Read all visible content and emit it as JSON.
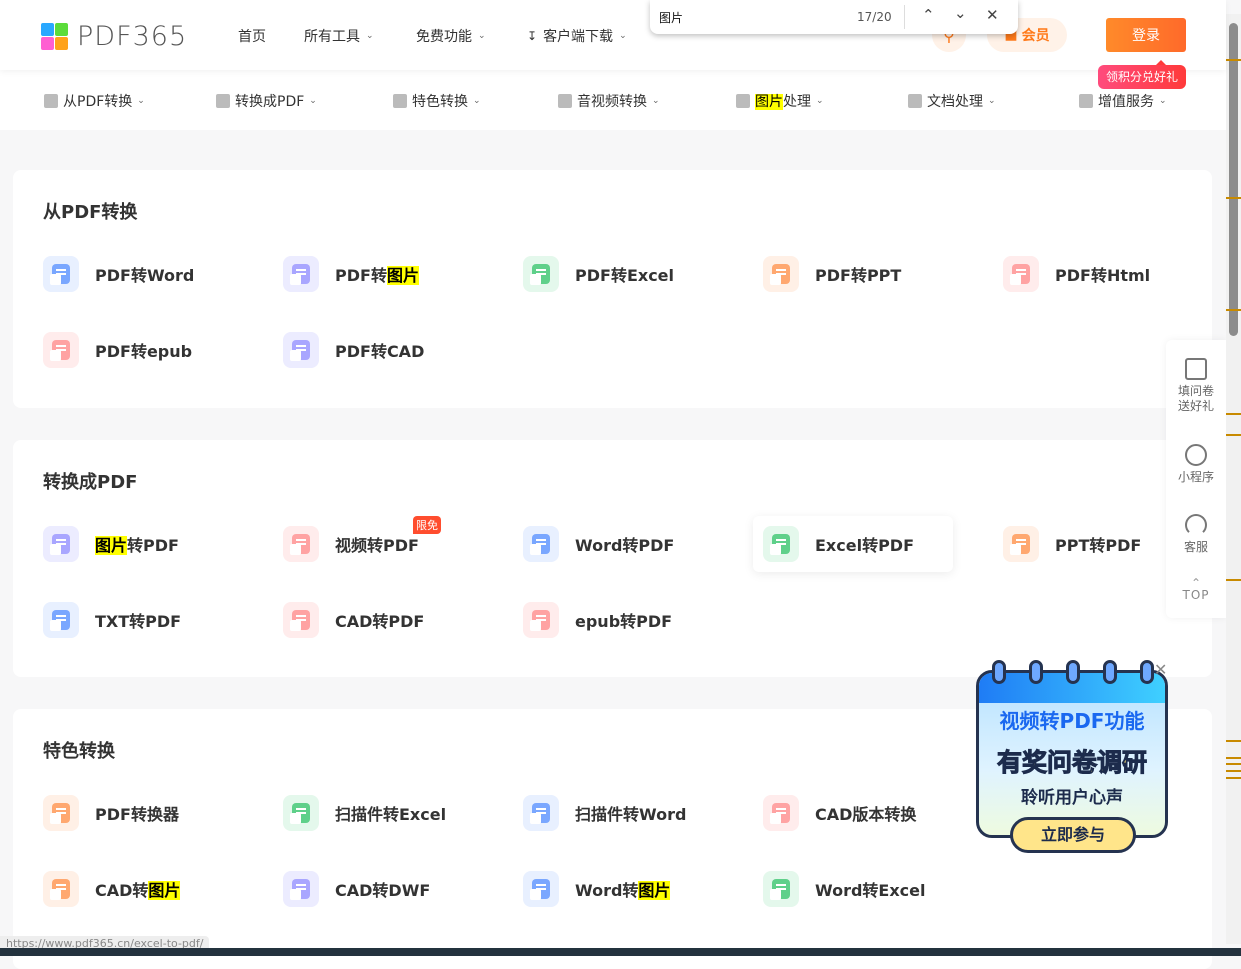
{
  "header": {
    "logo_text": "PDF365",
    "nav": [
      {
        "label": "首页"
      },
      {
        "label": "所有工具"
      },
      {
        "label": "免费功能"
      },
      {
        "label": "客户端下载"
      }
    ],
    "member_label": "会员",
    "login_label": "登录",
    "gift_tip": "领积分兑好礼"
  },
  "find_bar": {
    "query": "图片",
    "count": "17/20"
  },
  "subnav": [
    {
      "before": "从PDF转换",
      "hl": "",
      "after": ""
    },
    {
      "before": "转换成PDF",
      "hl": "",
      "after": ""
    },
    {
      "before": "特色转换",
      "hl": "",
      "after": ""
    },
    {
      "before": "音视频转换",
      "hl": "",
      "after": ""
    },
    {
      "before": "",
      "hl": "图片",
      "after": "处理"
    },
    {
      "before": "文档处理",
      "hl": "",
      "after": ""
    },
    {
      "before": "增值服务",
      "hl": "",
      "after": ""
    }
  ],
  "sections": [
    {
      "title": "从PDF转换",
      "tools": [
        {
          "before": "PDF转Word",
          "hl": "",
          "after": "",
          "color": "#7aa7ff",
          "bg": "#e8f0ff"
        },
        {
          "before": "PDF转",
          "hl": "图片",
          "after": "",
          "color": "#a9a6ff",
          "bg": "#ececff"
        },
        {
          "before": "PDF转Excel",
          "hl": "",
          "after": "",
          "color": "#5fd08a",
          "bg": "#e4f8ec"
        },
        {
          "before": "PDF转PPT",
          "hl": "",
          "after": "",
          "color": "#ffa870",
          "bg": "#fff0e6"
        },
        {
          "before": "PDF转Html",
          "hl": "",
          "after": "",
          "color": "#ffa3a3",
          "bg": "#ffecec"
        },
        {
          "before": "PDF转epub",
          "hl": "",
          "after": "",
          "color": "#ffa3a3",
          "bg": "#ffecec"
        },
        {
          "before": "PDF转CAD",
          "hl": "",
          "after": "",
          "color": "#a9a6ff",
          "bg": "#ececff"
        }
      ]
    },
    {
      "title": "转换成PDF",
      "tools": [
        {
          "before": "",
          "hl": "图片",
          "after": "转PDF",
          "color": "#a9a6ff",
          "bg": "#ececff"
        },
        {
          "before": "视频转PDF",
          "hl": "",
          "after": "",
          "color": "#ffa3a3",
          "bg": "#ffecec",
          "badge": "限免"
        },
        {
          "before": "Word转PDF",
          "hl": "",
          "after": "",
          "color": "#7aa7ff",
          "bg": "#e8f0ff"
        },
        {
          "before": "Excel转PDF",
          "hl": "",
          "after": "",
          "color": "#5fd08a",
          "bg": "#e4f8ec",
          "hover": true
        },
        {
          "before": "PPT转PDF",
          "hl": "",
          "after": "",
          "color": "#ffa870",
          "bg": "#fff0e6"
        },
        {
          "before": "TXT转PDF",
          "hl": "",
          "after": "",
          "color": "#7aa7ff",
          "bg": "#e8f0ff"
        },
        {
          "before": "CAD转PDF",
          "hl": "",
          "after": "",
          "color": "#ffa3a3",
          "bg": "#ffecec"
        },
        {
          "before": "epub转PDF",
          "hl": "",
          "after": "",
          "color": "#ffa3a3",
          "bg": "#ffecec"
        }
      ]
    },
    {
      "title": "特色转换",
      "tools": [
        {
          "before": "PDF转换器",
          "hl": "",
          "after": "",
          "color": "#ffa870",
          "bg": "#fff0e6"
        },
        {
          "before": "扫描件转Excel",
          "hl": "",
          "after": "",
          "color": "#5fd08a",
          "bg": "#e4f8ec"
        },
        {
          "before": "扫描件转Word",
          "hl": "",
          "after": "",
          "color": "#7aa7ff",
          "bg": "#e8f0ff"
        },
        {
          "before": "CAD版本转换",
          "hl": "",
          "after": "",
          "color": "#ffa3a3",
          "bg": "#ffecec"
        },
        {
          "before": "",
          "hl": "",
          "after": "",
          "skip": true
        },
        {
          "before": "CAD转",
          "hl": "图片",
          "after": "",
          "color": "#ffa870",
          "bg": "#fff0e6"
        },
        {
          "before": "CAD转DWF",
          "hl": "",
          "after": "",
          "color": "#a9a6ff",
          "bg": "#ececff"
        },
        {
          "before": "Word转",
          "hl": "图片",
          "after": "",
          "color": "#7aa7ff",
          "bg": "#e8f0ff"
        },
        {
          "before": "Word转Excel",
          "hl": "",
          "after": "",
          "color": "#5fd08a",
          "bg": "#e4f8ec"
        }
      ]
    }
  ],
  "sidebar": [
    {
      "label": "填问卷送好礼"
    },
    {
      "label": "小程序"
    },
    {
      "label": "客服"
    },
    {
      "label": "TOP"
    }
  ],
  "promo": {
    "line1": "视频转PDF功能",
    "line2": "有奖问卷调研",
    "line3": "聆听用户心声",
    "button": "立即参与"
  },
  "status_url": "https://www.pdf365.cn/excel-to-pdf/"
}
